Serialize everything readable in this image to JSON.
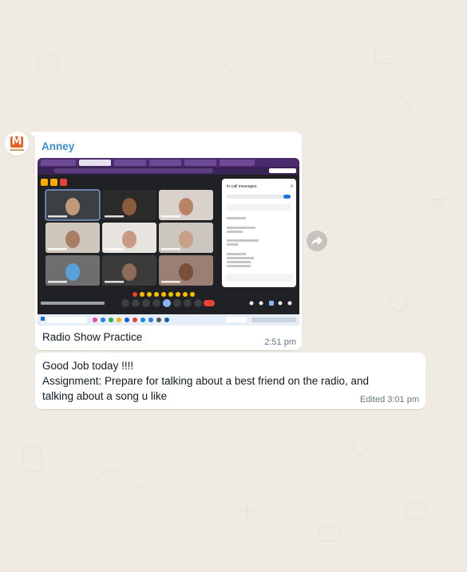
{
  "chat": {
    "message1": {
      "sender": "Anney",
      "caption": "Radio Show Practice",
      "time": "2:51 pm",
      "attachment": {
        "type": "image",
        "browser_tabs": 6,
        "side_panel_title": "In-call messages",
        "tiles": [
          {
            "face": "#c19a7a",
            "bg": "#3c4043"
          },
          {
            "face": "#8a5a3c",
            "bg": "#2a2a2a"
          },
          {
            "face": "#b98366",
            "bg": "#d9d2cc"
          },
          {
            "face": "#a97c66",
            "bg": "#cfc6bc"
          },
          {
            "face": "#c69a84",
            "bg": "#e7e3df"
          },
          {
            "face": "#caa086",
            "bg": "#cbc6c0"
          },
          {
            "face": "#5aa0d8",
            "bg": "#6e6e6e"
          },
          {
            "face": "#8e6a58",
            "bg": "#3b3b3b"
          },
          {
            "face": "#7a4f3a",
            "bg": "#9a7f74"
          }
        ]
      }
    },
    "message2": {
      "line1": "Good Job today !!!!",
      "line2": "Assignment: Prepare for talking about a best friend on the radio, and",
      "line3": "talking about a song u like",
      "edited_time": "Edited 3:01 pm"
    }
  },
  "colors": {
    "wallpaper": "#efeae2",
    "bubble": "#ffffff",
    "sender_name": "#3b8fd6",
    "meta_text": "#667781",
    "browser_frame": "#4b2a6e"
  },
  "icons": {
    "avatar": "logo-avatar",
    "forward": "forward-arrow-icon"
  }
}
